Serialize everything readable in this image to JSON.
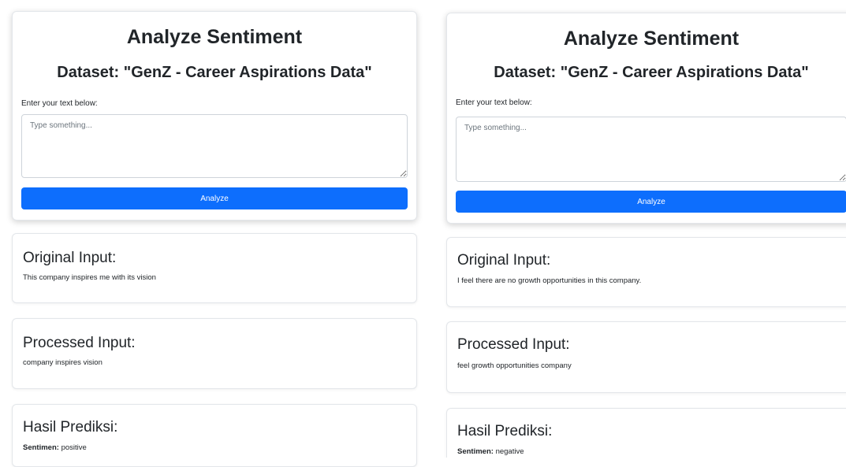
{
  "left": {
    "title": "Analyze Sentiment",
    "dataset": "Dataset: \"GenZ - Career Aspirations Data\"",
    "input_label": "Enter your text below:",
    "input_placeholder": "Type something...",
    "analyze_label": "Analyze",
    "original_heading": "Original Input:",
    "original_text": "This company inspires me with its vision",
    "processed_heading": "Processed Input:",
    "processed_text": "company inspires vision",
    "prediction_heading": "Hasil Prediksi:",
    "sentiment_label": "Sentimen:",
    "sentiment_value": "positive"
  },
  "right": {
    "title": "Analyze Sentiment",
    "dataset": "Dataset: \"GenZ - Career Aspirations Data\"",
    "input_label": "Enter your text below:",
    "input_placeholder": "Type something...",
    "analyze_label": "Analyze",
    "original_heading": "Original Input:",
    "original_text": "I feel there are no growth opportunities in this company.",
    "processed_heading": "Processed Input:",
    "processed_text": "feel growth opportunities company",
    "prediction_heading": "Hasil Prediksi:",
    "sentiment_label": "Sentimen:",
    "sentiment_value": "negative"
  }
}
